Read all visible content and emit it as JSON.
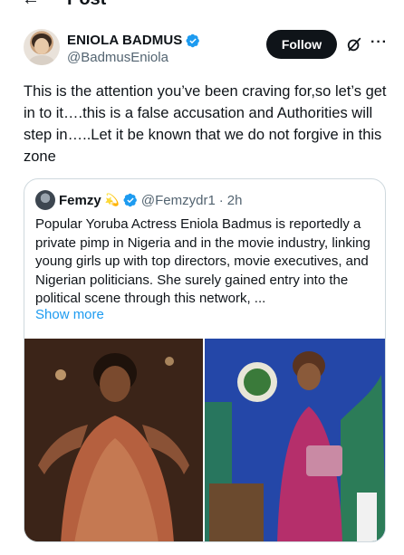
{
  "topbar": {
    "back_icon": "arrow-left-icon",
    "title": "Post"
  },
  "post": {
    "author_name": "ENIOLA BADMUS",
    "author_handle": "@BadmusEniola",
    "follow_label": "Follow",
    "more_label": "···",
    "text": "This is the attention you’ve been craving for,so let’s get in to it….this is a false accusation and Authorities will step in…..Let it be known that we do not forgive in this zone"
  },
  "quote": {
    "author_name": "Femzy",
    "emoji": "💫",
    "author_handle": "@Femzydr1",
    "separator": "·",
    "time": "2h",
    "text": "Popular Yoruba Actress Eniola Badmus is reportedly a private pimp in Nigeria and in the movie industry, linking young girls up with top directors, movie executives, and Nigerian politicians. She surely gained entry into the political scene through this network, ...",
    "show_more": "Show more"
  },
  "colors": {
    "accent": "#1d9bf0",
    "text": "#0f1419",
    "muted": "#536471",
    "border": "#cfd9de"
  }
}
